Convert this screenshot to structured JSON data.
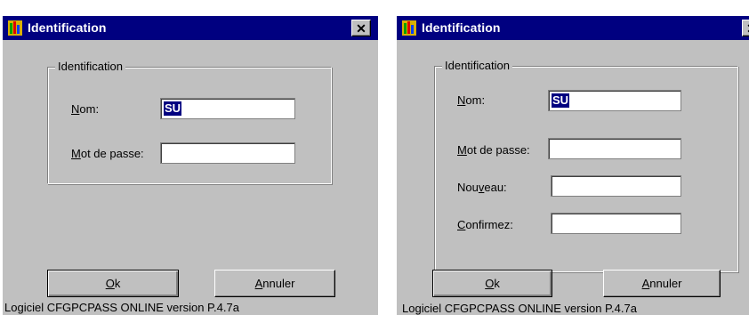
{
  "colors": {
    "title_bar": "#000080",
    "dialog_bg": "#c0c0c0",
    "selection": "#000080"
  },
  "dialog_left": {
    "title": "Identification",
    "close_glyph": "✕",
    "group_label": "Identification",
    "nom_label_ul": "N",
    "nom_label_rest": "om:",
    "nom_value": "SU",
    "mdp_label_ul": "M",
    "mdp_label_rest": "ot de passe:",
    "mdp_value": "",
    "ok_ul": "O",
    "ok_rest": "k",
    "cancel_ul": "A",
    "cancel_rest": "nnuler",
    "footer": "Logiciel CFGPCPASS ONLINE version P.4.7a"
  },
  "dialog_right": {
    "title": "Identification",
    "close_glyph": "✕",
    "group_label": "Identification",
    "nom_label_ul": "N",
    "nom_label_rest": "om:",
    "nom_value": "SU",
    "mdp_label_ul": "M",
    "mdp_label_rest": "ot de passe:",
    "mdp_value": "",
    "nouveau_label_pre": "Nou",
    "nouveau_label_ul": "v",
    "nouveau_label_rest": "eau:",
    "nouveau_value": "",
    "confirmez_label_ul": "C",
    "confirmez_label_rest": "onfirmez:",
    "confirmez_value": "",
    "ok_ul": "O",
    "ok_rest": "k",
    "cancel_ul": "A",
    "cancel_rest": "nnuler",
    "footer": "Logiciel CFGPCPASS ONLINE version P.4.7a"
  }
}
